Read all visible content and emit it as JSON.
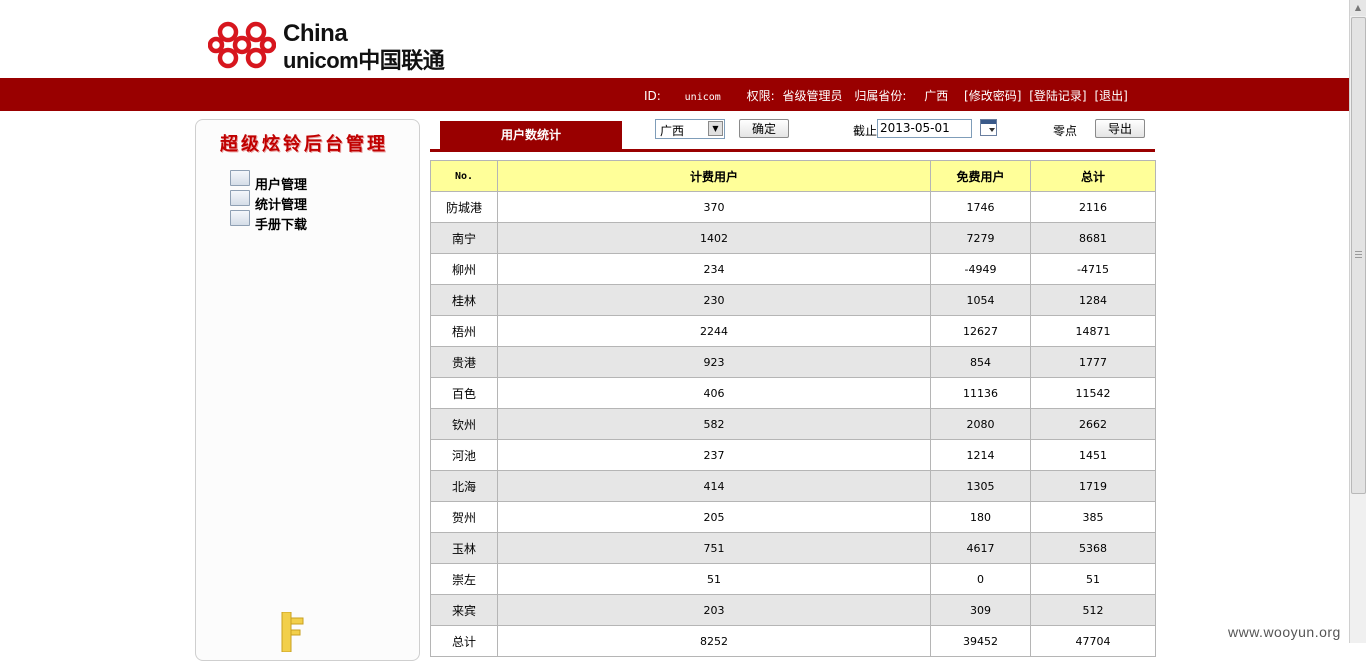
{
  "logo": {
    "line1": "China",
    "line2": "unicom中国联通"
  },
  "topbar": {
    "id_label": "ID:",
    "id_value": "unicom",
    "role_label": "权限:",
    "role_value": "省级管理员",
    "province_label": "归属省份:",
    "province_value": "广西",
    "links": [
      "[修改密码]",
      "[登陆记录]",
      "[退出]"
    ]
  },
  "sidebar": {
    "title": "超级炫铃后台管理",
    "items": [
      "用户管理",
      "统计管理",
      "手册下载"
    ]
  },
  "toolbar": {
    "tab_label": "用户数统计",
    "province_selected": "广西",
    "confirm_label": "确定",
    "date_label": "截止",
    "date_value": "2013-05-01",
    "time_label": "零点",
    "export_label": "导出"
  },
  "table": {
    "headers": [
      "No.",
      "计费用户",
      "免费用户",
      "总计"
    ],
    "rows": [
      [
        "防城港",
        "370",
        "1746",
        "2116"
      ],
      [
        "南宁",
        "1402",
        "7279",
        "8681"
      ],
      [
        "柳州",
        "234",
        "-4949",
        "-4715"
      ],
      [
        "桂林",
        "230",
        "1054",
        "1284"
      ],
      [
        "梧州",
        "2244",
        "12627",
        "14871"
      ],
      [
        "贵港",
        "923",
        "854",
        "1777"
      ],
      [
        "百色",
        "406",
        "11136",
        "11542"
      ],
      [
        "钦州",
        "582",
        "2080",
        "2662"
      ],
      [
        "河池",
        "237",
        "1214",
        "1451"
      ],
      [
        "北海",
        "414",
        "1305",
        "1719"
      ],
      [
        "贺州",
        "205",
        "180",
        "385"
      ],
      [
        "玉林",
        "751",
        "4617",
        "5368"
      ],
      [
        "崇左",
        "51",
        "0",
        "51"
      ],
      [
        "来宾",
        "203",
        "309",
        "512"
      ],
      [
        "总计",
        "8252",
        "39452",
        "47704"
      ]
    ]
  },
  "watermark": "www.wooyun.org",
  "colors": {
    "brand_red": "#990000",
    "header_yellow": "#ffff99",
    "row_alt": "#e6e6e6"
  }
}
